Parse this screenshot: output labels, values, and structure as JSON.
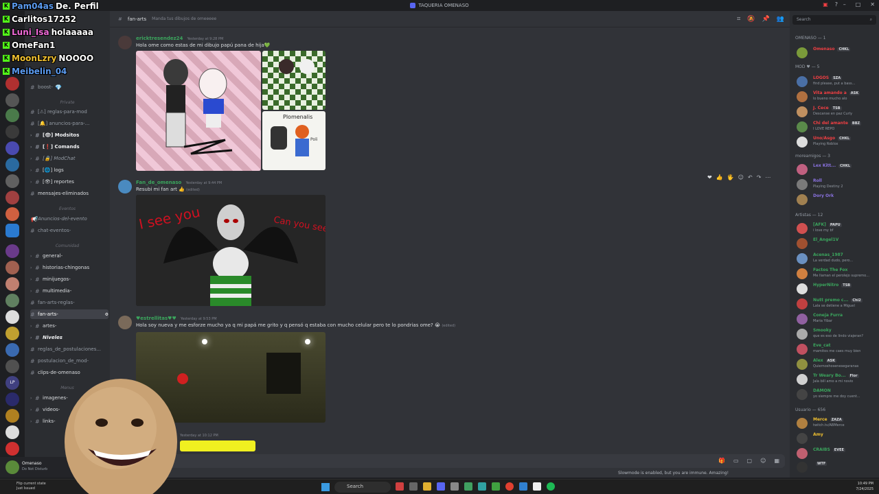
{
  "window": {
    "title": "TAQUERIA OMENASO"
  },
  "header": {
    "channel": "fan-arts",
    "topic": "Manda tus dibujos de omeeeee",
    "search_placeholder": "Search"
  },
  "overlay_chat": [
    {
      "user": "Pam04as",
      "msg": "De. Perfil",
      "color": "#5b9bf0"
    },
    {
      "user": "Carlitos17252",
      "msg": "",
      "color": "#ffffff"
    },
    {
      "user": "Luni_Isa",
      "msg": "holaaaaa",
      "color": "#f06bd8"
    },
    {
      "user": "OmeFan1",
      "msg": "",
      "color": "#ffffff"
    },
    {
      "user": "MoonLzry",
      "msg": "NOOOO",
      "color": "#f0c030"
    },
    {
      "user": "Meibelin_04",
      "msg": "",
      "color": "#5b9bf0"
    }
  ],
  "sidebar": {
    "categories": {
      "private": "Private",
      "eventos": "Eventos",
      "comunidad": "Comunidad",
      "menus": "Menus"
    },
    "channels": [
      {
        "label": "boost-"
      },
      {
        "label": "[⚠] reglas-para-mod"
      },
      {
        "label": "[🔔] anuncios-para-..."
      },
      {
        "label": "[👁] Modsitos"
      },
      {
        "label": "[❗] Comands"
      },
      {
        "label": "[🔒] ModChat"
      },
      {
        "label": "[🌐] logs"
      },
      {
        "label": "[👁] reportes"
      },
      {
        "label": "mensajes-eliminados"
      },
      {
        "label": "Anuncios-del-evento"
      },
      {
        "label": "chat-eventos-"
      },
      {
        "label": "general-"
      },
      {
        "label": "historias-chingonas"
      },
      {
        "label": "minijuegos-"
      },
      {
        "label": "multimedia-"
      },
      {
        "label": "fan-arts-reglas-"
      },
      {
        "label": "fan-arts-"
      },
      {
        "label": "artes-"
      },
      {
        "label": "Niveles"
      },
      {
        "label": "reglas_de_postulaciones..."
      },
      {
        "label": "postulacion_de_mod-"
      },
      {
        "label": "clips-de-omenaso"
      },
      {
        "label": "imagenes-"
      },
      {
        "label": "videos-"
      },
      {
        "label": "links-"
      }
    ],
    "user": {
      "name": "Omenaso",
      "status": "Do Not Disturb"
    }
  },
  "messages": [
    {
      "author": "ericktresendez24",
      "time": "Yesterday at 9:28 PM",
      "text": "Hola ome como estas de mi dibujo papú pana de hija💚",
      "color": "#3ba55d"
    },
    {
      "author": "Fan_de_omenaso",
      "time": "Yesterday at 9:44 PM",
      "text": "Resubi mi fan art 👍",
      "edited": "(edited)",
      "color": "#3ba55d"
    },
    {
      "author": "♥estrellitas♥♥",
      "time": "Yesterday at 9:53 PM",
      "text": "Hola soy nueva y me esforze mucho ya q mi papá me grito y q pensó q estaba con mucho celular pero te lo pondrias ome? 😭",
      "edited": "(edited)",
      "color": "#3ba55d"
    },
    {
      "author": "",
      "time": "Yesterday at 10:12 PM",
      "text": ""
    }
  ],
  "drawing_texts": {
    "see_left": "I see you",
    "see_right": "Can you see me?",
    "pl_name": "Plomenalis",
    "pl_small": "Poli"
  },
  "slowmode": "Slowmode is enabled, but you are immune. Amazing!",
  "members": {
    "groups": [
      "OMENASO — 1",
      "MOD ♥ — 5",
      "moreamigos — 3",
      "Artistas — 12",
      "Usuario — 656"
    ],
    "list": [
      {
        "name": "Omenaso",
        "tag": "CHKL",
        "status": "",
        "color": "#f23f43",
        "av": "#7a9a3a"
      },
      {
        "name": "LOGOS",
        "tag": "SZA",
        "status": "find please, put a bass...",
        "color": "#f23f43",
        "av": "#4a6fa5"
      },
      {
        "name": "Vita amando a",
        "tag": "ASK",
        "status": "lo bueno mucho alo",
        "color": "#f23f43",
        "av": "#b07040"
      },
      {
        "name": "J. Cece",
        "tag": "TSB",
        "status": "Descanse en paz Curly",
        "color": "#f23f43",
        "av": "#c09060"
      },
      {
        "name": "Chi del amante",
        "tag": "BBZ",
        "status": "I LOVE REPO",
        "color": "#f23f43",
        "av": "#5a8a4a"
      },
      {
        "name": "Uno/Asgo",
        "tag": "CHKL",
        "status": "Playing Roblox",
        "color": "#f23f43",
        "av": "#dddddd"
      },
      {
        "name": "Lex Kitt...",
        "tag": "CHKL",
        "status": "",
        "color": "#8a72e0",
        "av": "#c06080"
      },
      {
        "name": "Roll",
        "tag": "",
        "status": "Playing Destiny 2",
        "color": "#8a72e0",
        "av": "#7a7a7a"
      },
      {
        "name": "Dory Ork",
        "tag": "",
        "status": "",
        "color": "#8a72e0",
        "av": "#a08050"
      },
      {
        "name": "[AFK]",
        "tag": "PAPU",
        "status": "i love my bf",
        "color": "#3ba55d",
        "av": "#d05050"
      },
      {
        "name": "El_Angel1V",
        "tag": "",
        "status": "",
        "color": "#3ba55d",
        "av": "#a05030"
      },
      {
        "name": "Acenas_1987",
        "tag": "",
        "status": "La verdad dudo, pero...",
        "color": "#3ba55d",
        "av": "#6a90c0"
      },
      {
        "name": "Factos The Fox",
        "tag": "",
        "status": "Me llaman el perolejo supremo...",
        "color": "#3ba55d",
        "av": "#d08040"
      },
      {
        "name": "HyperNitro",
        "tag": "TSB",
        "status": "",
        "color": "#3ba55d",
        "av": "#dddddd"
      },
      {
        "name": "Nutt premo c...",
        "tag": "Chi2",
        "status": "Lala se detiene a Miguel",
        "color": "#3ba55d",
        "av": "#c04040"
      },
      {
        "name": "Coneja Furra",
        "tag": "",
        "status": "Maria Yibar",
        "color": "#3ba55d",
        "av": "#9060a0"
      },
      {
        "name": "Smooky",
        "tag": "",
        "status": "que es eso de lindo viajeran?",
        "color": "#3ba55d",
        "av": "#aaaaaa"
      },
      {
        "name": "Eve_cat",
        "tag": "",
        "status": "mamitos me caes muy bien",
        "color": "#3ba55d",
        "av": "#c05060"
      },
      {
        "name": "Alex",
        "tag": "ASK",
        "status": "Quiernoshosenesegaranas",
        "color": "#3ba55d",
        "av": "#909040"
      },
      {
        "name": "Tr Weary Bo...",
        "tag": "Flor",
        "status": "Jala bill amo a mi novio",
        "color": "#3ba55d",
        "av": "#d0d0d0"
      },
      {
        "name": "DAMON",
        "tag": "",
        "status": "yo siempre me doy cuent...",
        "color": "#3ba55d",
        "av": "#444444"
      },
      {
        "name": "Merce",
        "tag": "ZAZA",
        "status": "twitch.tv/ABMerce",
        "color": "#f0c030",
        "av": "#b08040"
      },
      {
        "name": "Amy",
        "tag": "",
        "status": "",
        "color": "#f0c030",
        "av": "#444444"
      },
      {
        "name": "CRAIBS",
        "tag": "EVEE",
        "status": "",
        "color": "#3ba55d",
        "av": "#c06070"
      },
      {
        "name": "",
        "tag": "WTF",
        "status": "",
        "color": "#f0c030",
        "av": "#333333"
      }
    ]
  },
  "taskbar": {
    "search": "Search",
    "tip": "Flip current state",
    "tip2": "Just Issued",
    "time": "10:49 PM",
    "date": "7/24/2025"
  },
  "colors": {
    "accent": "#5865f2",
    "bg_chat": "#313338",
    "bg_sidebar": "#2b2d31",
    "kick_green": "#53fc18"
  }
}
